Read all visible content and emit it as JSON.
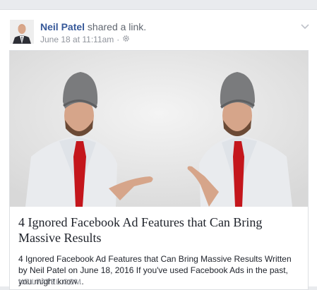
{
  "post": {
    "author": "Neil Patel",
    "action": "shared a link.",
    "timestamp": "June 18 at 11:11am",
    "separator": "·",
    "privacy_icon": "gear-icon",
    "menu_icon": "chevron-down-icon"
  },
  "link": {
    "title": "4 Ignored Facebook Ad Features that Can Bring Massive Results",
    "description": "4 Ignored Facebook Ad Features that Can Bring Massive Results Written by Neil Patel on June 18, 2016 If you've used Facebook Ads in the past, you might know...",
    "domain": "NEILPATEL.COM"
  },
  "colors": {
    "author_link": "#365899",
    "meta_text": "#90949c",
    "body_text": "#1d2129",
    "tie": "#c4161c"
  }
}
